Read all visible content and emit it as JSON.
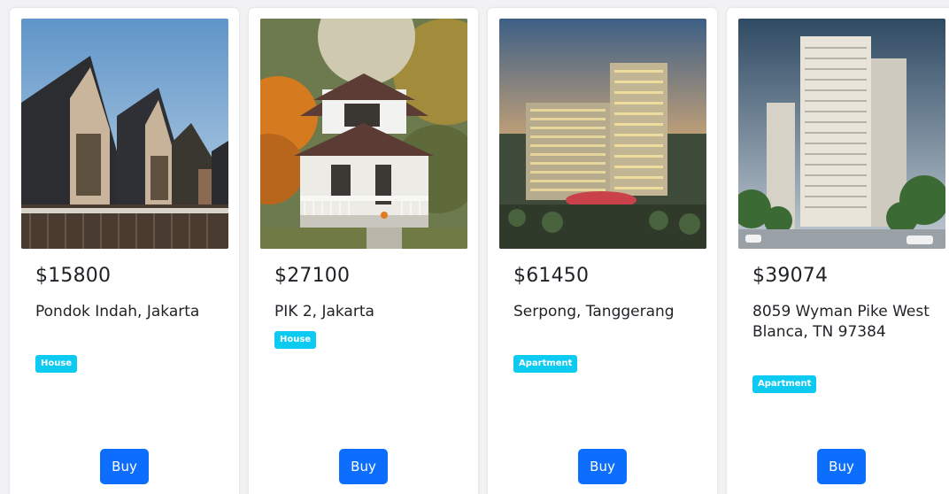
{
  "listings": [
    {
      "price": "$15800",
      "address": "Pondok Indah, Jakarta",
      "type": "House",
      "button": "Buy",
      "photo": "modern-gabled-houses-photo"
    },
    {
      "price": "$27100",
      "address": "PIK 2, Jakarta",
      "type": "House",
      "button": "Buy",
      "photo": "two-storey-house-photo"
    },
    {
      "price": "$61450",
      "address": "Serpong, Tanggerang",
      "type": "Apartment",
      "button": "Buy",
      "photo": "apartment-towers-dusk-photo"
    },
    {
      "price": "$39074",
      "address": "8059 Wyman Pike West Blanca, TN 97384",
      "type": "Apartment",
      "button": "Buy",
      "photo": "highrise-apartment-photo"
    }
  ],
  "colors": {
    "badge": "#0dcaf0",
    "button": "#0d6efd",
    "card": "#ffffff",
    "background": "#f2f2f4"
  }
}
